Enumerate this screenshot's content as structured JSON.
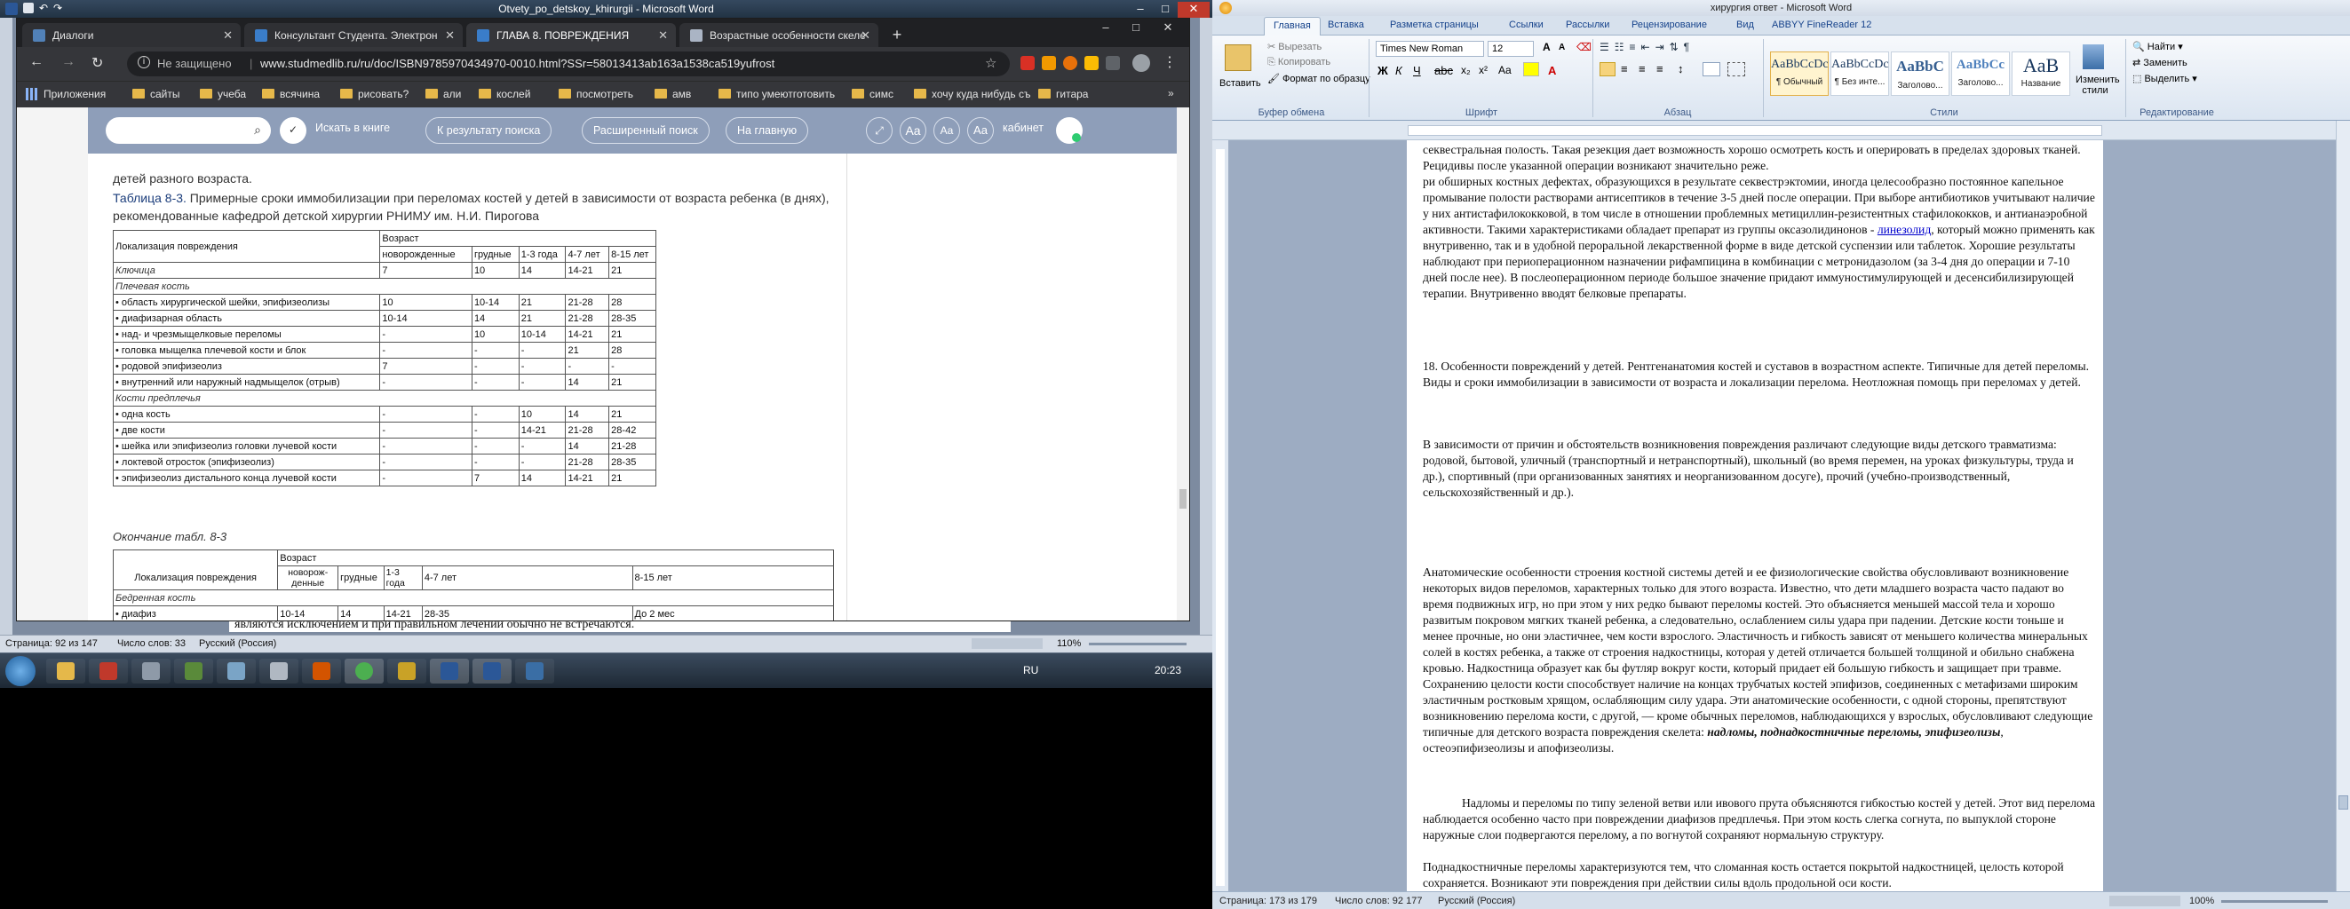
{
  "left_word": {
    "title": "Otvety_po_detskoy_khirurgii - Microsoft Word",
    "status": {
      "page": "Страница: 92 из 147",
      "words": "Число слов: 33",
      "lang": "Русский (Россия)",
      "zoom": "110%"
    },
    "hidden_text": "являются исключением и при правильном лечении обычно не встречаются."
  },
  "chrome": {
    "tabs": [
      {
        "label": "Диалоги"
      },
      {
        "label": "Консультант Студента. Электрон"
      },
      {
        "label": "ГЛАВА 8. ПОВРЕЖДЕНИЯ"
      },
      {
        "label": "Возрастные особенности скеле"
      }
    ],
    "new_tab": "+",
    "address": {
      "security": "Не защищено",
      "url": "www.studmedlib.ru/ru/doc/ISBN9785970434970-0010.html?SSr=58013413ab163a1538ca519yufrost"
    },
    "bookmarks": [
      "Приложения",
      "сайты",
      "учеба",
      "всячина",
      "рисовать?",
      "али",
      "кослей",
      "посмотреть",
      "амв",
      "типо умеютготовить",
      "симс",
      "хочу куда нибудь съ",
      "гитара"
    ],
    "site": {
      "search_placeholder": "",
      "search_in_book": "Искать в книге",
      "to_results": "К результату поиска",
      "advanced": "Расширенный поиск",
      "home": "На главную",
      "text_size": "Aa",
      "cabinet": "кабинет"
    },
    "doc": {
      "prev_text": "детей разного возраста.",
      "table_caption_bold": "Таблица 8-3.",
      "table_caption": " Примерные сроки иммобилизации при переломах костей у детей в зависимости от возраста ребенка (в днях), рекомендованные кафедрой детской хирургии РНИМУ им. Н.И. Пирогова",
      "table": {
        "head_loc": "Локализация повреждения",
        "head_age": "Возраст",
        "cols": [
          "новорожденные",
          "грудные",
          "1-3 года",
          "4-7 лет",
          "8-15 лет"
        ],
        "rows": [
          {
            "label": "Ключица",
            "sec": true,
            "v": [
              "7",
              "10",
              "14",
              "14-21",
              "21"
            ]
          },
          {
            "label": "Плечевая кость",
            "sec": true,
            "header": true,
            "v": [
              "",
              "",
              "",
              "",
              ""
            ]
          },
          {
            "label": "• область хирургической шейки, эпифизеолизы",
            "v": [
              "10",
              "10-14",
              "21",
              "21-28",
              "28"
            ]
          },
          {
            "label": "• диафизарная область",
            "v": [
              "10-14",
              "14",
              "21",
              "21-28",
              "28-35"
            ]
          },
          {
            "label": "• над- и чрезмыщелковые переломы",
            "v": [
              "-",
              "10",
              "10-14",
              "14-21",
              "21"
            ]
          },
          {
            "label": "• головка мыщелка плечевой кости и блок",
            "v": [
              "-",
              "-",
              "-",
              "21",
              "28"
            ]
          },
          {
            "label": "• родовой эпифизеолиз",
            "v": [
              "7",
              "-",
              "-",
              "-",
              "-"
            ]
          },
          {
            "label": "• внутренний или наружный надмыщелок (отрыв)",
            "v": [
              "-",
              "-",
              "-",
              "14",
              "21"
            ]
          },
          {
            "label": "Кости предплечья",
            "sec": true,
            "header": true,
            "v": [
              "",
              "",
              "",
              "",
              ""
            ]
          },
          {
            "label": "• одна кость",
            "v": [
              "-",
              "-",
              "10",
              "14",
              "21"
            ]
          },
          {
            "label": "• две кости",
            "v": [
              "-",
              "-",
              "14-21",
              "21-28",
              "28-42"
            ]
          },
          {
            "label": "• шейка или эпифизеолиз головки лучевой кости",
            "v": [
              "-",
              "-",
              "-",
              "14",
              "21-28"
            ]
          },
          {
            "label": "• локтевой отросток (эпифизеолиз)",
            "v": [
              "-",
              "-",
              "-",
              "21-28",
              "28-35"
            ]
          },
          {
            "label": "• эпифизеолиз дистального конца лучевой кости",
            "v": [
              "-",
              "7",
              "14",
              "14-21",
              "21"
            ]
          }
        ]
      },
      "table2_caption": "Окончание табл. 8-3",
      "table2": {
        "head_age": "Возраст",
        "head_loc": "Локализация повреждения",
        "cols": [
          "новорож-денные",
          "грудные",
          "1-3 года",
          "4-7 лет",
          "8-15 лет"
        ],
        "section": "Бедренная кость",
        "row": {
          "label": "• диафиз",
          "v": [
            "10-14",
            "14",
            "14-21",
            "28-35",
            "До 2 мес"
          ]
        }
      }
    }
  },
  "taskbar": {
    "lang": "RU",
    "clock": "20:23"
  },
  "right_word": {
    "title": "хирургия ответ - Microsoft Word",
    "tabs": [
      "Главная",
      "Вставка",
      "Разметка страницы",
      "Ссылки",
      "Рассылки",
      "Рецензирование",
      "Вид",
      "ABBYY FineReader 12"
    ],
    "ribbon": {
      "paste": "Вставить",
      "cut": "Вырезать",
      "copy": "Копировать",
      "format_painter": "Формат по образцу",
      "clipboard": "Буфер обмена",
      "font_name": "Times New Roman",
      "font_size": "12",
      "font_group": "Шрифт",
      "paragraph_group": "Абзац",
      "styles_group": "Стили",
      "styles": [
        {
          "preview": "AaBbCcDc",
          "name": "¶ Обычный"
        },
        {
          "preview": "AaBbCcDc",
          "name": "¶ Без инте..."
        },
        {
          "preview": "AaBbC",
          "name": "Заголово..."
        },
        {
          "preview": "AaBbCc",
          "name": "Заголово..."
        },
        {
          "preview": "AaB",
          "name": "Название"
        }
      ],
      "change_styles": "Изменить стили",
      "find": "Найти",
      "replace": "Заменить",
      "select": "Выделить",
      "editing": "Редактирование"
    },
    "doc": {
      "p1": "секвестральная полость. Такая резекция дает возможность хорошо осмотреть кость и оперировать в пределах здоровых тканей. Рецидивы после указанной операции возникают значительно реже.",
      "p2": "ри обширных костных дефектах, образующихся в результате секвестрэктомии, иногда целесообразно постоянное капельное промывание полости растворами антисептиков в течение 3-5 дней после операции. При выборе антибиотиков учитывают наличие у них антистафилококковой, в том числе в отношении проблемных метициллин-резистентных стафилококков, и антианаэробной активности. Такими характеристиками обладает препарат из группы оксазолидинонов -",
      "link": "линезолид",
      "p2b": ", который можно применять как внутривенно, так и в удобной пероральной лекарственной форме в виде детской суспензии или таблеток. Хорошие результаты наблюдают при периоперационном назначении рифампицина в комбинации с метронидазолом (за 3-4 дня до операции и 7-10 дней после нее). В послеоперационном периоде большое значение придают иммуностимулирующей и десенсибилизирующей терапии. Внутривенно вводят белковые препараты.",
      "heading": "18. Особенности повреждений у детей. Рентгенанатомия костей и суставов в возрастном аспекте. Типичные для детей переломы. Виды и сроки иммобилизации в зависимости от возраста и локализации перелома. Неотложная помощь при переломах у детей.",
      "p3": "В зависимости от причин и обстоятельств возникновения повреждения различают следующие виды детского травматизма: родовой, бытовой, уличный (транспортный и нетранспортный), школьный (во время перемен, на уроках физкультуры, труда и др.), спортивный (при организованных занятиях и неорганизованном досуге), прочий (учебно-производственный, сельскохозяйственный и др.).",
      "p4": "Анатомические особенности строения костной системы детей и ее физиологические свойства обусловливают возникновение некоторых видов переломов, характерных только для этого возраста. Известно, что дети младшего возраста часто падают во время подвижных игр, но при этом у них редко бывают переломы костей. Это объясняется меньшей массой тела и хорошо развитым покровом мягких тканей ребенка, а следовательно, ослаблением силы удара при падении. Детские кости тоньше и менее прочные, но они эластичнее, чем кости взрослого. Эластичность и гибкость зависят от меньшего количества минеральных солей в костях ребенка, а также от строения надкостницы, которая у детей отличается большей толщиной и обильно снабжена кровью. Надкостница образует как бы футляр вокруг кости, который придает ей большую гибкость и защищает при травме. Сохранению целости кости способствует наличие на концах трубчатых костей эпифизов, соединенных с метафизами широким эластичным ростковым хрящом, ослабляющим силу удара. Эти анатомические особенности, с одной стороны, препятствуют возникновению перелома кости, с другой, — кроме обычных переломов, наблюдающихся у взрослых, обусловливают следующие типичные для детского возраста повреждения скелета:",
      "p4_em": "надломы, поднадкостничные переломы, эпифизеолизы",
      "p4_end": ", остеоэпифизеолизы и апофизеолизы.",
      "p5": "Надломы и переломы по типу зеленой ветви или ивового прута объясняются гибкостью костей у детей. Этот вид перелома наблюдается особенно часто при повреждении диафизов предплечья. При этом кость слегка согнута, по выпуклой стороне наружные слои подвергаются перелому, а по вогнутой сохраняют нормальную структуру.",
      "p6": "Поднадкостничные переломы характеризуются тем, что сломанная кость остается покрытой надкостницей, целость которой сохраняется. Возникают эти повреждения при действии силы вдоль продольной оси кости."
    },
    "status": {
      "page": "Страница: 173 из 179",
      "words": "Число слов: 92 177",
      "lang": "Русский (Россия)",
      "zoom": "100%"
    }
  },
  "colors": {
    "word_frame": "#c9d2de",
    "chrome_dark": "#35363a",
    "site_bar": "#8e9eb9",
    "ribbon_text": "#15428b",
    "link": "#0000cc"
  }
}
